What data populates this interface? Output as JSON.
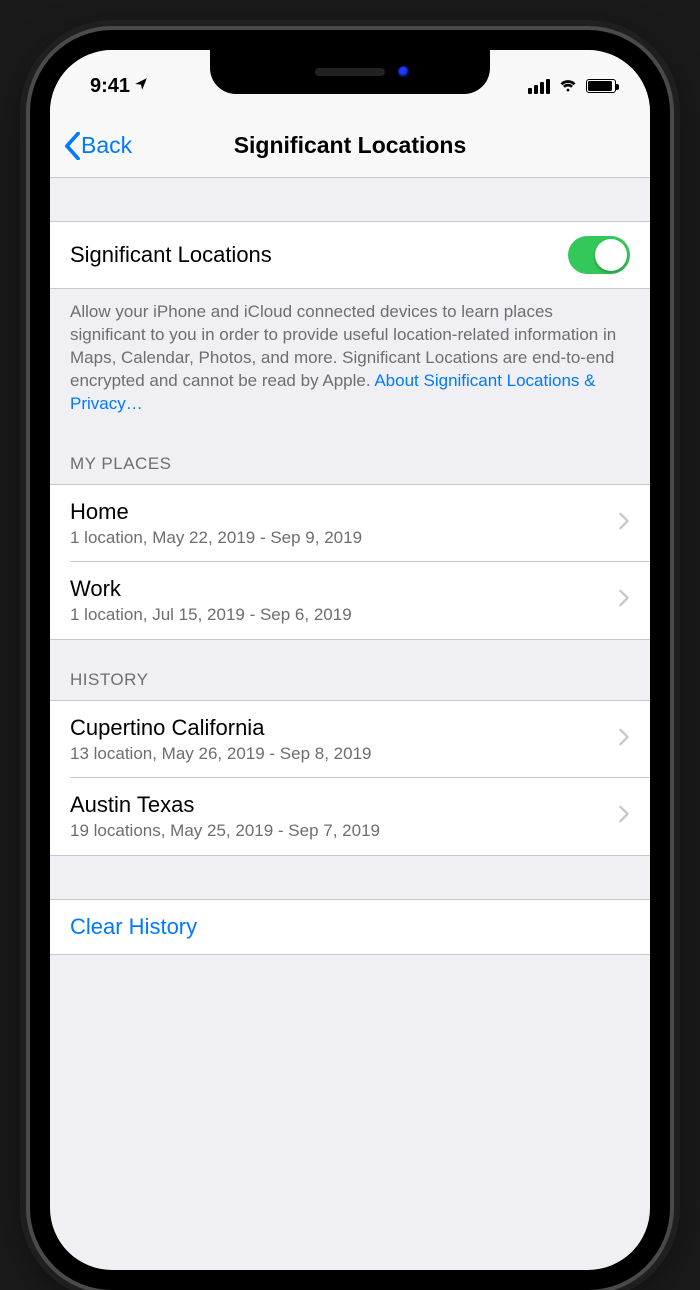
{
  "statusbar": {
    "time": "9:41"
  },
  "navbar": {
    "back_label": "Back",
    "title": "Significant Locations"
  },
  "main_toggle": {
    "label": "Significant Locations",
    "on": true
  },
  "description": {
    "text": "Allow your iPhone and iCloud connected devices to learn places significant to you in order to provide useful location-related information in Maps, Calendar, Photos, and more. Significant Locations are end-to-end encrypted and cannot be read by Apple. ",
    "link_text": "About Significant Locations & Privacy…"
  },
  "sections": {
    "my_places": {
      "header": "MY PLACES",
      "items": [
        {
          "title": "Home",
          "subtitle": "1 location, May 22, 2019 - Sep 9, 2019"
        },
        {
          "title": "Work",
          "subtitle": "1 location, Jul 15, 2019 - Sep 6, 2019"
        }
      ]
    },
    "history": {
      "header": "HISTORY",
      "items": [
        {
          "title": "Cupertino California",
          "subtitle": "13 location, May 26, 2019 - Sep 8, 2019"
        },
        {
          "title": "Austin Texas",
          "subtitle": "19 locations, May 25, 2019 - Sep 7, 2019"
        }
      ]
    }
  },
  "clear_history_label": "Clear History",
  "colors": {
    "accent": "#007aff",
    "switch_on": "#34c759",
    "bg": "#efeff4",
    "separator": "#c8c7cc",
    "secondary_text": "#6d6d72"
  }
}
